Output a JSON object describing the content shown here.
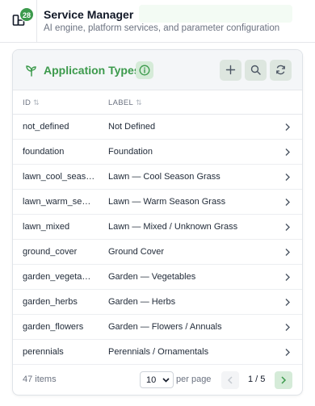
{
  "header": {
    "badge_count": "28",
    "title": "Service Manager",
    "subtitle": "AI engine, platform services, and parameter configuration"
  },
  "panel": {
    "title": "Application Types",
    "accent_color": "#3c9a4c",
    "icons": {
      "title": "sprout-icon",
      "info": "info-icon",
      "add": "plus-icon",
      "search": "search-icon",
      "refresh": "refresh-icon"
    }
  },
  "table": {
    "columns": [
      {
        "label": "ID",
        "sort_icon": "⇅"
      },
      {
        "label": "LABEL",
        "sort_icon": "⇅"
      }
    ],
    "rows": [
      {
        "id": "not_defined",
        "label": "Not Defined"
      },
      {
        "id": "foundation",
        "label": "Foundation"
      },
      {
        "id": "lawn_cool_season_grass",
        "label": "Lawn — Cool Season Grass"
      },
      {
        "id": "lawn_warm_season_grass",
        "label": "Lawn — Warm Season Grass"
      },
      {
        "id": "lawn_mixed",
        "label": "Lawn — Mixed / Unknown Grass"
      },
      {
        "id": "ground_cover",
        "label": "Ground Cover"
      },
      {
        "id": "garden_vegetables",
        "label": "Garden — Vegetables"
      },
      {
        "id": "garden_herbs",
        "label": "Garden — Herbs"
      },
      {
        "id": "garden_flowers",
        "label": "Garden — Flowers / Annuals"
      },
      {
        "id": "perennials",
        "label": "Perennials / Ornamentals"
      }
    ]
  },
  "footer": {
    "items_count": "47 items",
    "page_size": "10",
    "per_page_label": "per page",
    "page_indicator": "1 / 5"
  }
}
